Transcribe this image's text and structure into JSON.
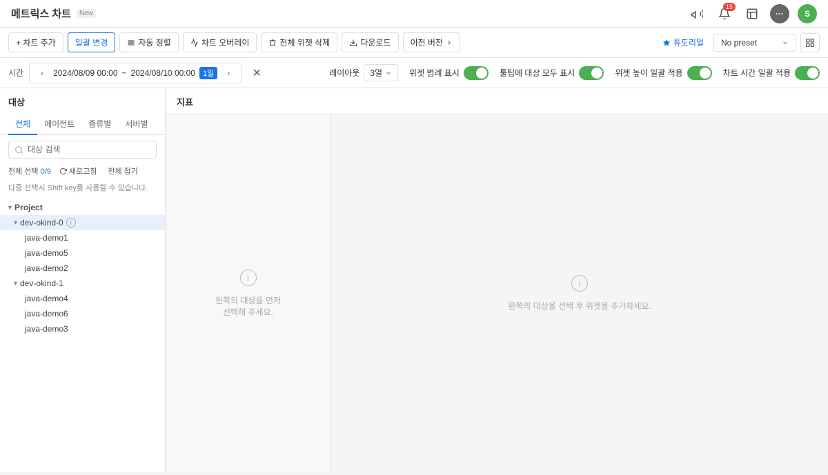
{
  "header": {
    "title": "메트릭스 차트",
    "new_badge": "New",
    "notification_count": "15",
    "avatar_multi": "···",
    "avatar_s": "S"
  },
  "toolbar": {
    "add_chart": "+ 차트 추가",
    "batch_edit": "일괄 변경",
    "auto_arrange": "자동 정렬",
    "chart_overlay": "차트 오버레이",
    "delete_all_widgets": "전체 위젯 삭제",
    "download": "다운로드",
    "prev_version": "이전 버전",
    "tutorial": "튜토리얼",
    "no_preset": "No preset"
  },
  "time_bar": {
    "label": "시간",
    "start": "2024/08/09",
    "start_time": "00:00",
    "tilde": "~",
    "end": "2024/08/10",
    "end_time": "00:00",
    "day_badge": "1일",
    "layout_label": "레이아웃",
    "layout_value": "3열",
    "widget_legend": "위젯 범례 표시",
    "tooltip_all": "툴팁에 대상 모두 표시",
    "widget_height": "위젯 높이 일괄 적용",
    "chart_time": "차트 시간 일괄 적용"
  },
  "left_panel": {
    "title": "대상",
    "tabs": [
      "전체",
      "에이전트",
      "종류별",
      "서버별"
    ],
    "active_tab": "전체",
    "search_placeholder": "대상 검색",
    "total_selected": "0",
    "total_count": "9",
    "refresh_label": "새로고침",
    "deselect_all": "전체 접기",
    "multi_hint": "다중 선택시 Shift key를 사용할 수 있습니다.",
    "project_label": "Project",
    "groups": [
      {
        "name": "dev-okind-0",
        "active": true,
        "items": [
          "java-demo1",
          "java-demo5",
          "java-demo2"
        ]
      },
      {
        "name": "dev-okind-1",
        "active": false,
        "items": [
          "java-demo4",
          "java-demo6",
          "java-demo3"
        ]
      }
    ]
  },
  "right_panel": {
    "title": "지표",
    "left_empty_text": "왼쪽의 대상을 먼저\n선택해 주세요.",
    "right_empty_text": "왼쪽의 대상을 선택 후 위젯을 추가하세요."
  },
  "icons": {
    "bell": "🔔",
    "megaphone": "📢",
    "grid": "⊞",
    "chevron_down": "▾",
    "chevron_right": "›",
    "chevron_left": "‹",
    "chevron_up": "▴",
    "search": "🔍",
    "refresh": "↻",
    "info": "i",
    "plus": "+",
    "download": "↓",
    "tutorial_star": "✦",
    "close": "✕"
  }
}
